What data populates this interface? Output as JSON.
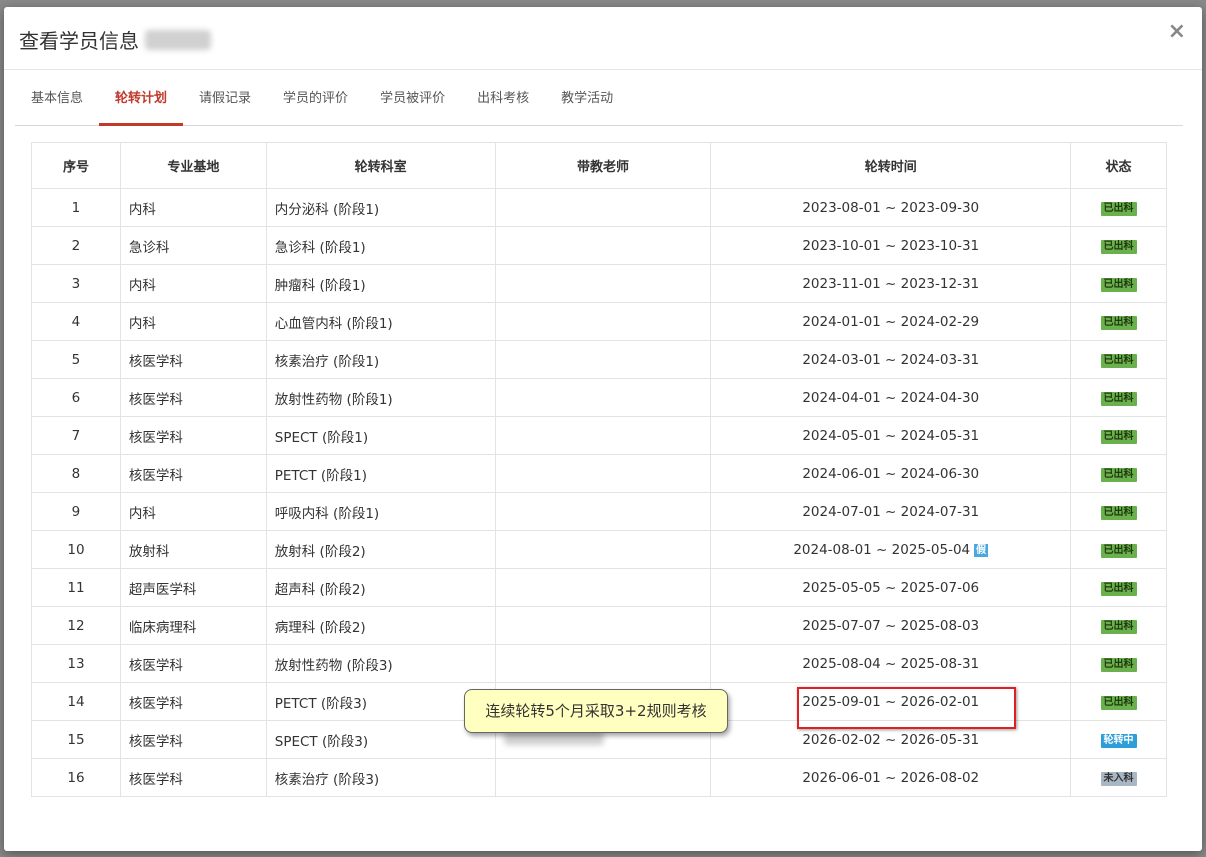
{
  "modal": {
    "title": "查看学员信息",
    "close": "×"
  },
  "tabs": [
    "基本信息",
    "轮转计划",
    "请假记录",
    "学员的评价",
    "学员被评价",
    "出科考核",
    "教学活动"
  ],
  "table": {
    "headers": [
      "序号",
      "专业基地",
      "轮转科室",
      "带教老师",
      "轮转时间",
      "状态"
    ],
    "rows": [
      {
        "no": "1",
        "base": "内科",
        "dept": "内分泌科 (阶段1)",
        "time": "2023-08-01 ~ 2023-09-30",
        "status": "已出科",
        "status_type": "done"
      },
      {
        "no": "2",
        "base": "急诊科",
        "dept": "急诊科 (阶段1)",
        "time": "2023-10-01 ~ 2023-10-31",
        "status": "已出科",
        "status_type": "done"
      },
      {
        "no": "3",
        "base": "内科",
        "dept": "肿瘤科 (阶段1)",
        "time": "2023-11-01 ~ 2023-12-31",
        "status": "已出科",
        "status_type": "done"
      },
      {
        "no": "4",
        "base": "内科",
        "dept": "心血管内科 (阶段1)",
        "time": "2024-01-01 ~ 2024-02-29",
        "status": "已出科",
        "status_type": "done"
      },
      {
        "no": "5",
        "base": "核医学科",
        "dept": "核素治疗 (阶段1)",
        "time": "2024-03-01 ~ 2024-03-31",
        "status": "已出科",
        "status_type": "done"
      },
      {
        "no": "6",
        "base": "核医学科",
        "dept": "放射性药物 (阶段1)",
        "time": "2024-04-01 ~ 2024-04-30",
        "status": "已出科",
        "status_type": "done"
      },
      {
        "no": "7",
        "base": "核医学科",
        "dept": "SPECT (阶段1)",
        "time": "2024-05-01 ~ 2024-05-31",
        "status": "已出科",
        "status_type": "done"
      },
      {
        "no": "8",
        "base": "核医学科",
        "dept": "PETCT (阶段1)",
        "time": "2024-06-01 ~ 2024-06-30",
        "status": "已出科",
        "status_type": "done"
      },
      {
        "no": "9",
        "base": "内科",
        "dept": "呼吸内科 (阶段1)",
        "time": "2024-07-01 ~ 2024-07-31",
        "status": "已出科",
        "status_type": "done"
      },
      {
        "no": "10",
        "base": "放射科",
        "dept": "放射科 (阶段2)",
        "time": "2024-08-01 ~ 2025-05-04",
        "leave_tag": "假",
        "status": "已出科",
        "status_type": "done"
      },
      {
        "no": "11",
        "base": "超声医学科",
        "dept": "超声科 (阶段2)",
        "time": "2025-05-05 ~ 2025-07-06",
        "status": "已出科",
        "status_type": "done"
      },
      {
        "no": "12",
        "base": "临床病理科",
        "dept": "病理科 (阶段2)",
        "time": "2025-07-07 ~ 2025-08-03",
        "status": "已出科",
        "status_type": "done"
      },
      {
        "no": "13",
        "base": "核医学科",
        "dept": "放射性药物 (阶段3)",
        "time": "2025-08-04 ~ 2025-08-31",
        "status": "已出科",
        "status_type": "done"
      },
      {
        "no": "14",
        "base": "核医学科",
        "dept": "PETCT (阶段3)",
        "time": "2025-09-01 ~ 2026-02-01",
        "status": "已出科",
        "status_type": "done"
      },
      {
        "no": "15",
        "base": "核医学科",
        "dept": "SPECT (阶段3)",
        "time": "2026-02-02 ~ 2026-05-31",
        "teacher_blurred": true,
        "status": "轮转中",
        "status_type": "current"
      },
      {
        "no": "16",
        "base": "核医学科",
        "dept": "核素治疗 (阶段3)",
        "time": "2026-06-01 ~ 2026-08-02",
        "status": "未入科",
        "status_type": "not"
      }
    ]
  },
  "annotation": {
    "tooltip": "连续轮转5个月采取3+2规则考核"
  },
  "colors": {
    "accent": "#c0392b",
    "done": "#6ab04c",
    "current": "#2e9ed8",
    "not": "#a9b6c4",
    "highlight": "#e02020"
  }
}
